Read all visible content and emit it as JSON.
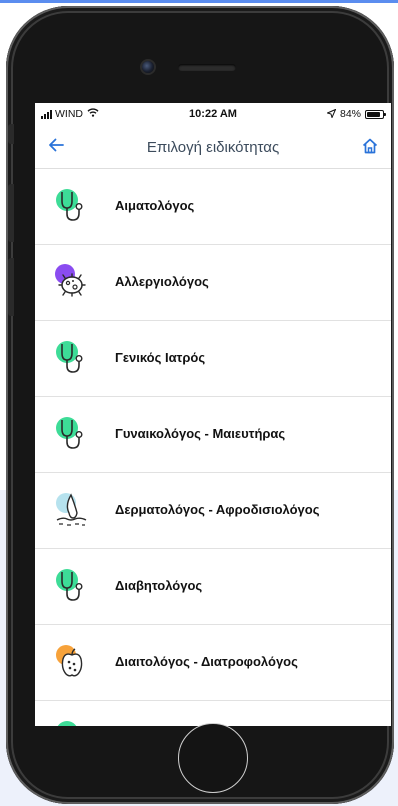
{
  "status_bar": {
    "carrier": "WIND",
    "time": "10:22 AM",
    "battery": "84%",
    "battery_level": 0.84
  },
  "nav": {
    "title": "Επιλογή ειδικότητας",
    "back_icon": "arrow-left-icon",
    "home_icon": "home-icon"
  },
  "colors": {
    "accent": "#2a73d9",
    "green": "#3ddc97",
    "purple": "#8a4cf0",
    "light_blue": "#b6e2ee",
    "orange": "#f7a23a"
  },
  "specialties": [
    {
      "label": "Αιματολόγος",
      "icon": "stethoscope-icon"
    },
    {
      "label": "Αλλεργιολόγος",
      "icon": "virus-icon"
    },
    {
      "label": "Γενικός Ιατρός",
      "icon": "stethoscope-icon"
    },
    {
      "label": "Γυναικολόγος - Μαιευτήρας",
      "icon": "stethoscope-icon"
    },
    {
      "label": "Δερματολόγος - Αφροδισιολόγος",
      "icon": "skin-icon"
    },
    {
      "label": "Διαβητολόγος",
      "icon": "stethoscope-icon"
    },
    {
      "label": "Διαιτολόγος - Διατροφολόγος",
      "icon": "apple-icon"
    }
  ]
}
